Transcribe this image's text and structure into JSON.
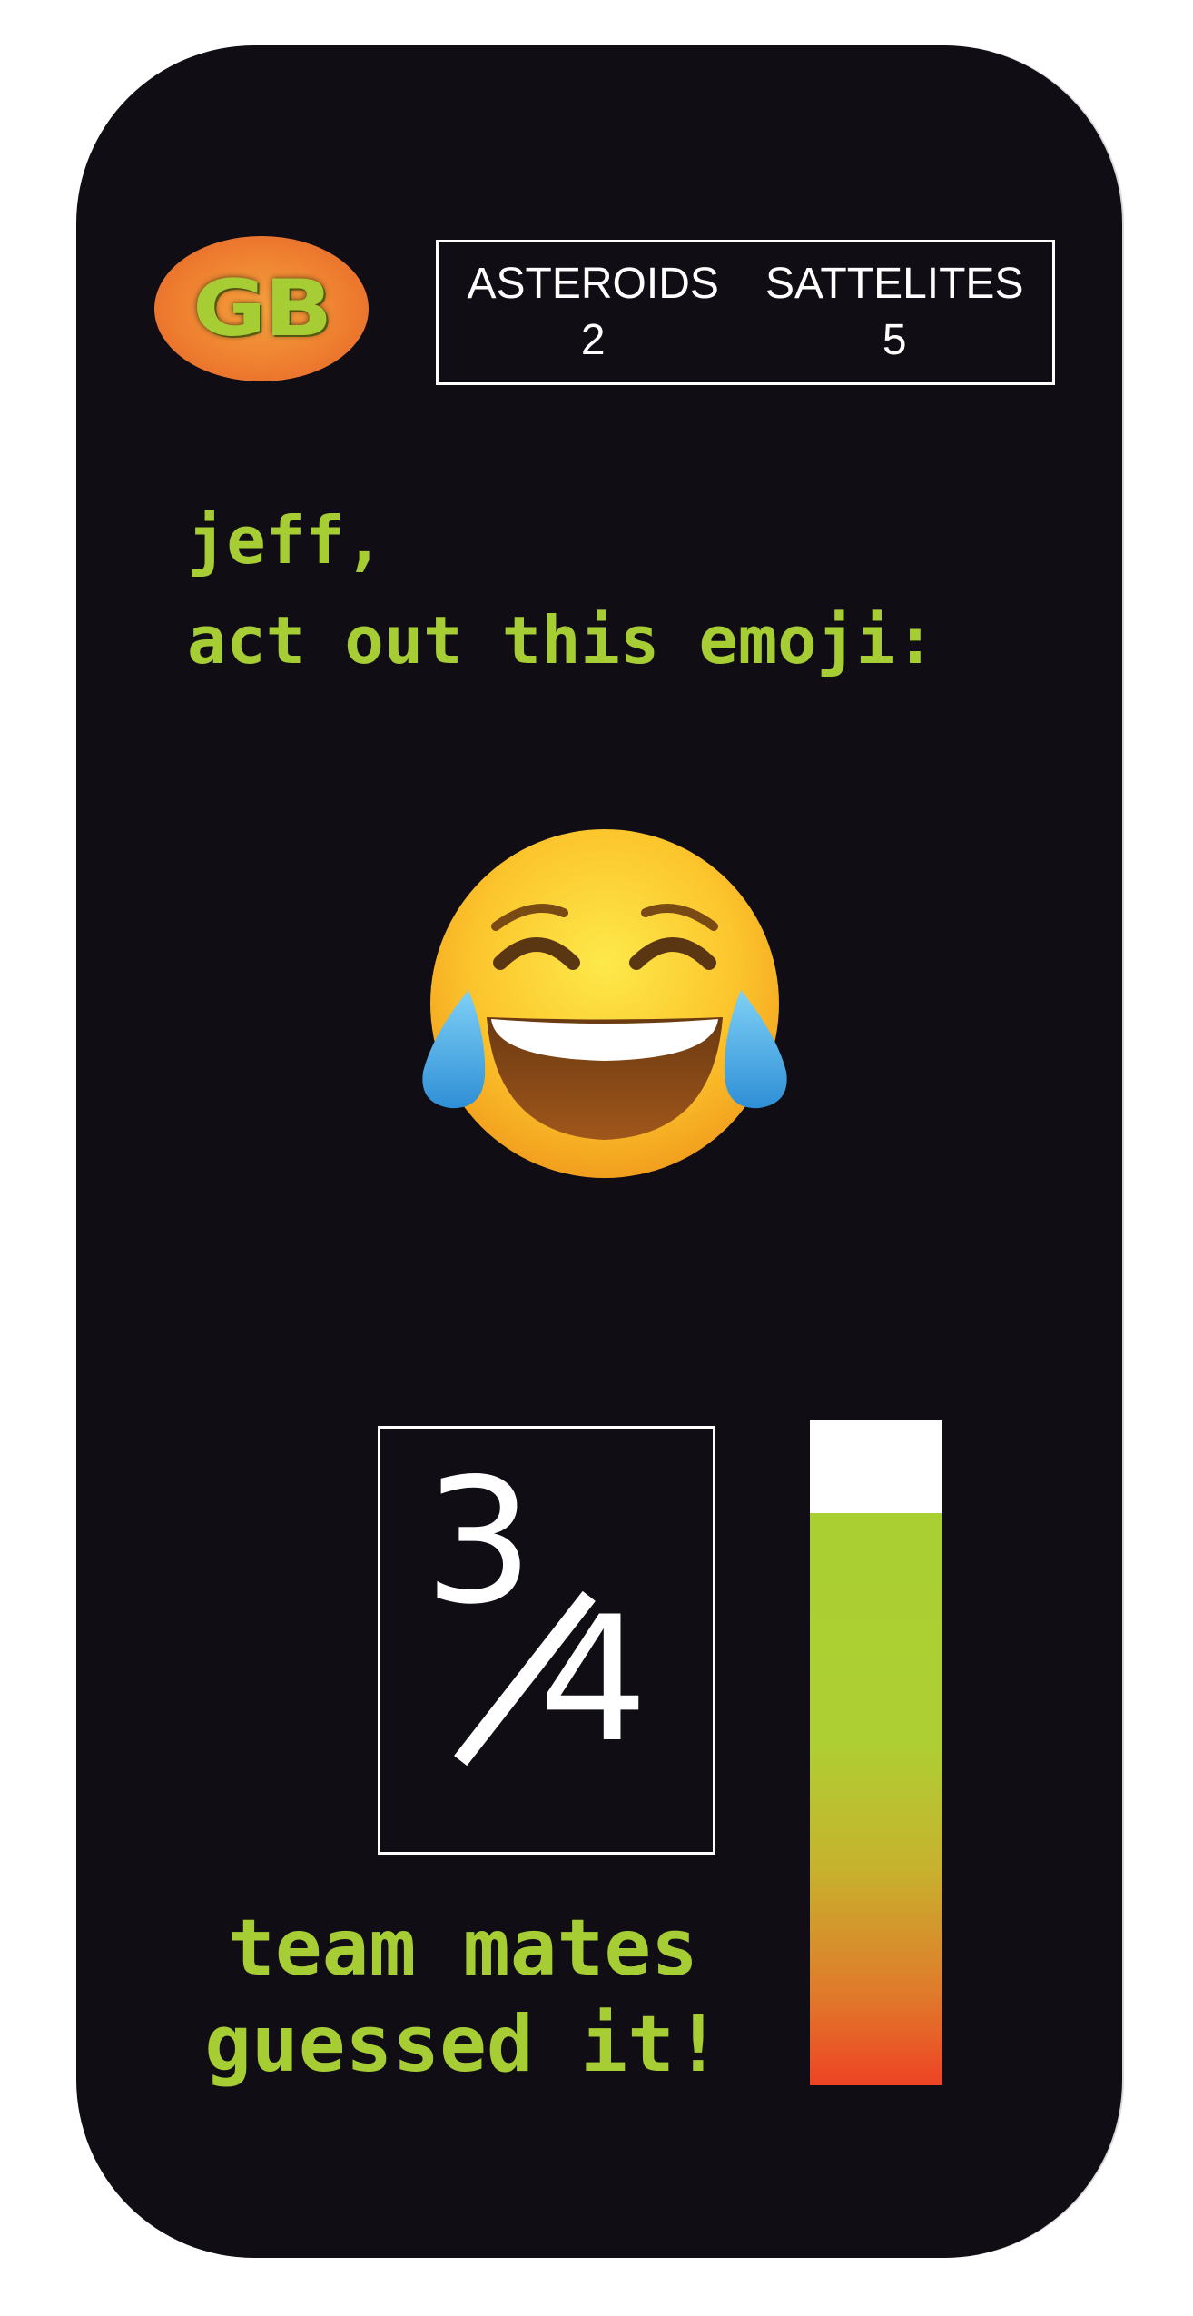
{
  "logo": {
    "text": "GB"
  },
  "scoreboard": {
    "columns": [
      {
        "label": "ASTEROIDS",
        "value": "2"
      },
      {
        "label": "SATTELITES",
        "value": "5"
      }
    ]
  },
  "prompt": {
    "line1": "jeff,",
    "line2": "act out this emoji:"
  },
  "emoji": {
    "icon": "face-with-tears-of-joy-icon"
  },
  "progress": {
    "numerator": "3",
    "denominator": "4",
    "fraction": 0.86
  },
  "caption": {
    "line1": "team mates",
    "line2": "guessed it!"
  },
  "colors": {
    "background": "#110d15",
    "accent": "#a7cd35",
    "logo_orange": "#ee7c2f",
    "meter_bottom": "#ee4324"
  }
}
